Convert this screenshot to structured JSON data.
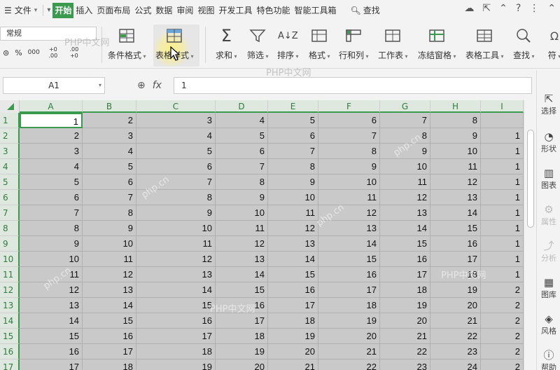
{
  "menu": {
    "file": "文件",
    "tabs": [
      "开始",
      "插入",
      "页面布局",
      "公式",
      "数据",
      "审阅",
      "视图",
      "开发工具",
      "特色功能",
      "智能工具箱"
    ],
    "active_tab": "开始",
    "search": "查找"
  },
  "ribbon": {
    "number_format": "常规",
    "numfmt_percent": "%",
    "numfmt_comma": "000",
    "numfmt_inc": "+0 .00",
    "numfmt_dec": ".00 +0",
    "buttons": [
      "条件格式",
      "表格样式",
      "求和",
      "筛选",
      "排序",
      "格式",
      "行和列",
      "工作表",
      "冻结窗格",
      "表格工具",
      "查找",
      "符"
    ]
  },
  "formula_bar": {
    "name_box": "A1",
    "fx": "fx",
    "value": "1"
  },
  "sheet": {
    "columns": [
      "A",
      "B",
      "C",
      "D",
      "E",
      "F",
      "G",
      "H",
      "I"
    ],
    "rows": [
      [
        "1",
        "2",
        "3",
        "4",
        "5",
        "6",
        "7",
        "8",
        ""
      ],
      [
        "2",
        "3",
        "4",
        "5",
        "6",
        "7",
        "8",
        "9",
        "1"
      ],
      [
        "3",
        "4",
        "5",
        "6",
        "7",
        "8",
        "9",
        "10",
        "1"
      ],
      [
        "4",
        "5",
        "6",
        "7",
        "8",
        "9",
        "10",
        "11",
        "1"
      ],
      [
        "5",
        "6",
        "7",
        "8",
        "9",
        "10",
        "11",
        "12",
        "1"
      ],
      [
        "6",
        "7",
        "8",
        "9",
        "10",
        "11",
        "12",
        "13",
        "1"
      ],
      [
        "7",
        "8",
        "9",
        "10",
        "11",
        "12",
        "13",
        "14",
        "1"
      ],
      [
        "8",
        "9",
        "10",
        "11",
        "12",
        "13",
        "14",
        "15",
        "1"
      ],
      [
        "9",
        "10",
        "11",
        "12",
        "13",
        "14",
        "15",
        "16",
        "1"
      ],
      [
        "10",
        "11",
        "12",
        "13",
        "14",
        "15",
        "16",
        "17",
        "1"
      ],
      [
        "11",
        "12",
        "13",
        "14",
        "15",
        "16",
        "17",
        "18",
        "1"
      ],
      [
        "12",
        "13",
        "14",
        "15",
        "16",
        "17",
        "18",
        "19",
        "2"
      ],
      [
        "13",
        "14",
        "15",
        "16",
        "17",
        "18",
        "19",
        "20",
        "2"
      ],
      [
        "14",
        "15",
        "16",
        "17",
        "18",
        "19",
        "20",
        "21",
        "2"
      ],
      [
        "15",
        "16",
        "17",
        "18",
        "19",
        "20",
        "21",
        "22",
        "2"
      ],
      [
        "16",
        "17",
        "18",
        "19",
        "20",
        "21",
        "22",
        "23",
        "2"
      ],
      [
        "17",
        "18",
        "19",
        "20",
        "21",
        "22",
        "23",
        "24",
        "2"
      ]
    ],
    "row_numbers": [
      "1",
      "2",
      "3",
      "4",
      "5",
      "6",
      "7",
      "8",
      "9",
      "10",
      "11",
      "12",
      "13",
      "14",
      "15",
      "16",
      "17"
    ]
  },
  "right_panel": {
    "items": [
      "选择",
      "形状",
      "图表",
      "属性",
      "分析",
      "图库",
      "风格",
      "帮助"
    ]
  },
  "watermarks": [
    "PHP中文网",
    "php.cn"
  ]
}
